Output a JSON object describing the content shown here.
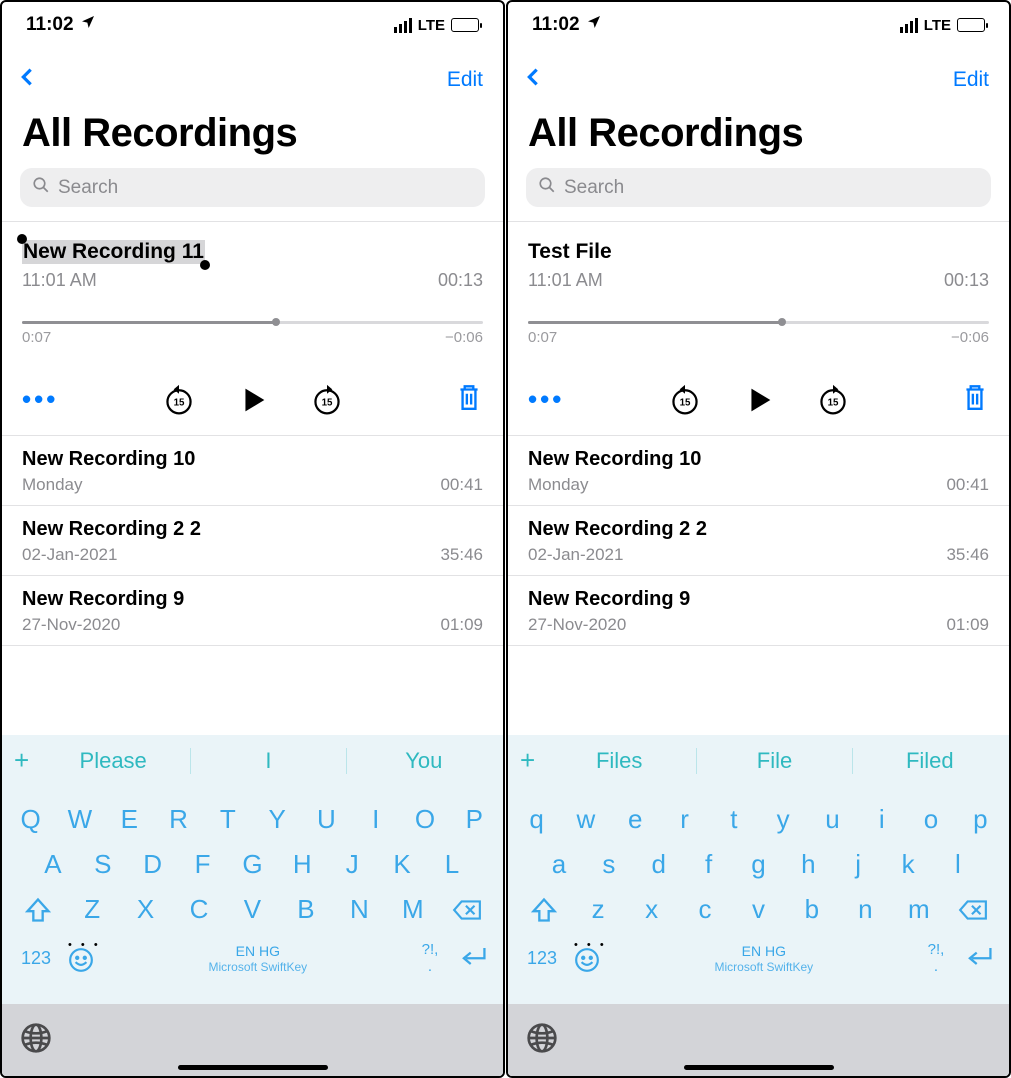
{
  "left": {
    "status": {
      "time": "11:02",
      "network": "LTE"
    },
    "nav": {
      "edit": "Edit"
    },
    "title": "All Recordings",
    "search_placeholder": "Search",
    "expanded": {
      "name": "New Recording 11",
      "selected": true,
      "timestamp": "11:01 AM",
      "duration": "00:13",
      "elapsed": "0:07",
      "remaining": "−0:06",
      "progress_pct": 55
    },
    "items": [
      {
        "name": "New Recording 10",
        "date": "Monday",
        "duration": "00:41"
      },
      {
        "name": "New Recording 2 2",
        "date": "02-Jan-2021",
        "duration": "35:46"
      },
      {
        "name": "New Recording 9",
        "date": "27-Nov-2020",
        "duration": "01:09"
      }
    ],
    "keyboard": {
      "suggestions": [
        "Please",
        "I",
        "You"
      ],
      "row1": [
        "Q",
        "W",
        "E",
        "R",
        "T",
        "Y",
        "U",
        "I",
        "O",
        "P"
      ],
      "row2": [
        "A",
        "S",
        "D",
        "F",
        "G",
        "H",
        "J",
        "K",
        "L"
      ],
      "row3": [
        "Z",
        "X",
        "C",
        "V",
        "B",
        "N",
        "M"
      ],
      "uppercase": true,
      "numkey": "123",
      "lang": "EN HG",
      "brand": "Microsoft SwiftKey",
      "punct_top": "?!,",
      "punct_bot": "."
    }
  },
  "right": {
    "status": {
      "time": "11:02",
      "network": "LTE"
    },
    "nav": {
      "edit": "Edit"
    },
    "title": "All Recordings",
    "search_placeholder": "Search",
    "expanded": {
      "name": "Test File",
      "selected": false,
      "timestamp": "11:01 AM",
      "duration": "00:13",
      "elapsed": "0:07",
      "remaining": "−0:06",
      "progress_pct": 55
    },
    "items": [
      {
        "name": "New Recording 10",
        "date": "Monday",
        "duration": "00:41"
      },
      {
        "name": "New Recording 2 2",
        "date": "02-Jan-2021",
        "duration": "35:46"
      },
      {
        "name": "New Recording 9",
        "date": "27-Nov-2020",
        "duration": "01:09"
      }
    ],
    "keyboard": {
      "suggestions": [
        "Files",
        "File",
        "Filed"
      ],
      "row1": [
        "q",
        "w",
        "e",
        "r",
        "t",
        "y",
        "u",
        "i",
        "o",
        "p"
      ],
      "row2": [
        "a",
        "s",
        "d",
        "f",
        "g",
        "h",
        "j",
        "k",
        "l"
      ],
      "row3": [
        "z",
        "x",
        "c",
        "v",
        "b",
        "n",
        "m"
      ],
      "uppercase": false,
      "numkey": "123",
      "lang": "EN HG",
      "brand": "Microsoft SwiftKey",
      "punct_top": "?!,",
      "punct_bot": "."
    }
  }
}
